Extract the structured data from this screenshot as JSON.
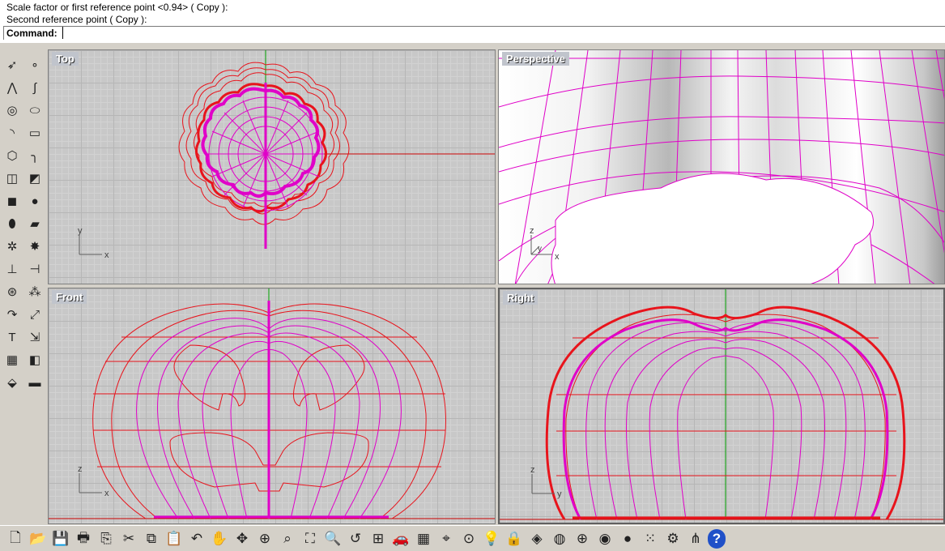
{
  "command": {
    "history": [
      "Scale factor or first reference point <0.94> ( Copy ):",
      "Second reference point ( Copy ):"
    ],
    "prompt_label": "Command:",
    "input_value": ""
  },
  "viewports": {
    "top": {
      "title": "Top",
      "axis_labels": [
        "y",
        "x"
      ]
    },
    "perspective": {
      "title": "Perspective",
      "axis_labels": [
        "z",
        "y",
        "x"
      ]
    },
    "front": {
      "title": "Front",
      "axis_labels": [
        "z",
        "x"
      ]
    },
    "right": {
      "title": "Right",
      "axis_labels": [
        "z",
        "y"
      ]
    }
  },
  "colors": {
    "curve_red": "#e8141c",
    "curve_magenta": "#e000c8",
    "axis_green": "#00a000",
    "axis_red": "#c80000"
  },
  "left_toolbar": [
    "select-arrow-icon",
    "point-icon",
    "polyline-icon",
    "curve-icon",
    "circle-icon",
    "ellipse-icon",
    "arc-icon",
    "rectangle-icon",
    "polygon-icon",
    "fillet-curve-icon",
    "surface-icon",
    "surface-fillet-icon",
    "box-solid-icon",
    "sphere-icon",
    "cylinder-icon",
    "mesh-plane-icon",
    "transform-gear-icon",
    "explode-icon",
    "trim-icon",
    "split-icon",
    "boolean-icon",
    "group-icon",
    "offset-icon",
    "dimension-icon",
    "text-icon",
    "scale-icon",
    "array-icon",
    "mirror-icon",
    "analyze-icon",
    "ruler-icon"
  ],
  "bottom_toolbar": [
    "new-file-icon",
    "open-folder-icon",
    "save-icon",
    "print-icon",
    "import-icon",
    "cut-icon",
    "copy-icon",
    "paste-icon",
    "undo-icon",
    "pan-hand-icon",
    "rotate-view-icon",
    "zoom-dynamic-icon",
    "zoom-window-icon",
    "zoom-extents-icon",
    "zoom-selected-icon",
    "undo-view-icon",
    "four-viewports-icon",
    "car-icon",
    "grid-icon",
    "snap-icon",
    "osnap-icon",
    "light-bulb-icon",
    "lock-icon",
    "layer-icon",
    "color-wheel-icon",
    "sphere-wire-icon",
    "render-sphere-icon",
    "shaded-sphere-icon",
    "point-cloud-icon",
    "gear-options-icon",
    "tree-icon",
    "help-icon"
  ]
}
